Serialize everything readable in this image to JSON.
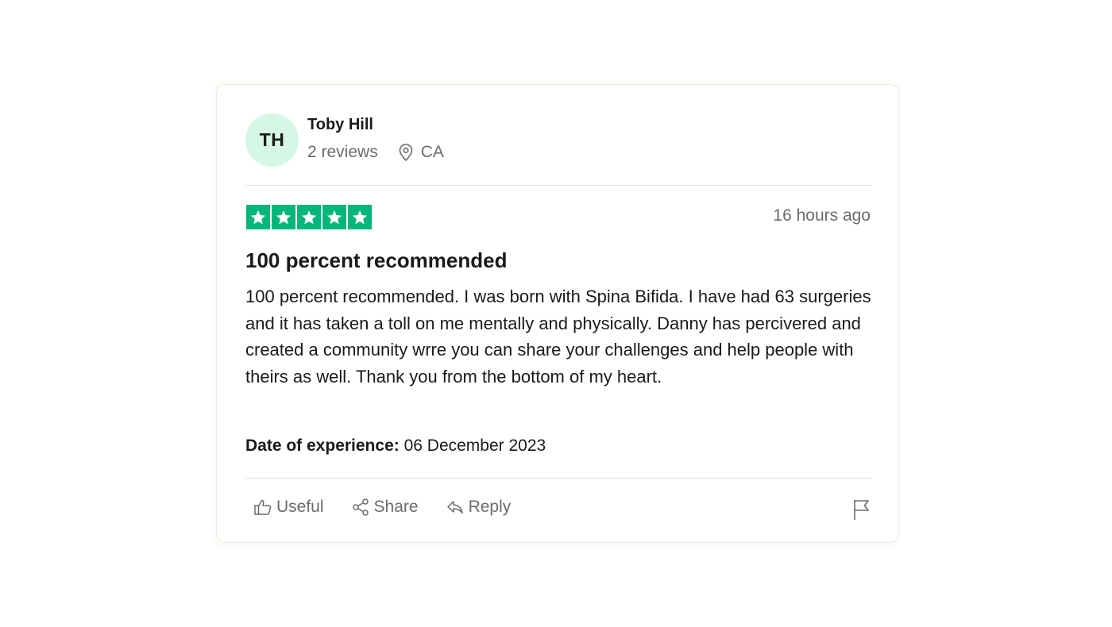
{
  "reviewer": {
    "initials": "TH",
    "name": "Toby Hill",
    "review_count": "2 reviews",
    "location": "CA",
    "location_icon": "map-pin-icon",
    "avatar_color": "#d6f6e6"
  },
  "review": {
    "rating": 5,
    "rating_max": 5,
    "star_color": "#00b67a",
    "posted": "16 hours ago",
    "title": "100 percent recommended",
    "body": "100 percent recommended. I was born with Spina Bifida. I have had 63 surgeries and it has taken a toll on me mentally and physically. Danny has percivered and created a community wrre you can share your challenges and help people with theirs as well. Thank you from the bottom of my heart.",
    "experience_label": "Date of experience:",
    "experience_date": "06 December 2023"
  },
  "actions": {
    "useful_label": "Useful",
    "useful_icon": "thumbs-up-icon",
    "share_label": "Share",
    "share_icon": "share-icon",
    "reply_label": "Reply",
    "reply_icon": "reply-icon",
    "flag_icon": "flag-icon"
  }
}
